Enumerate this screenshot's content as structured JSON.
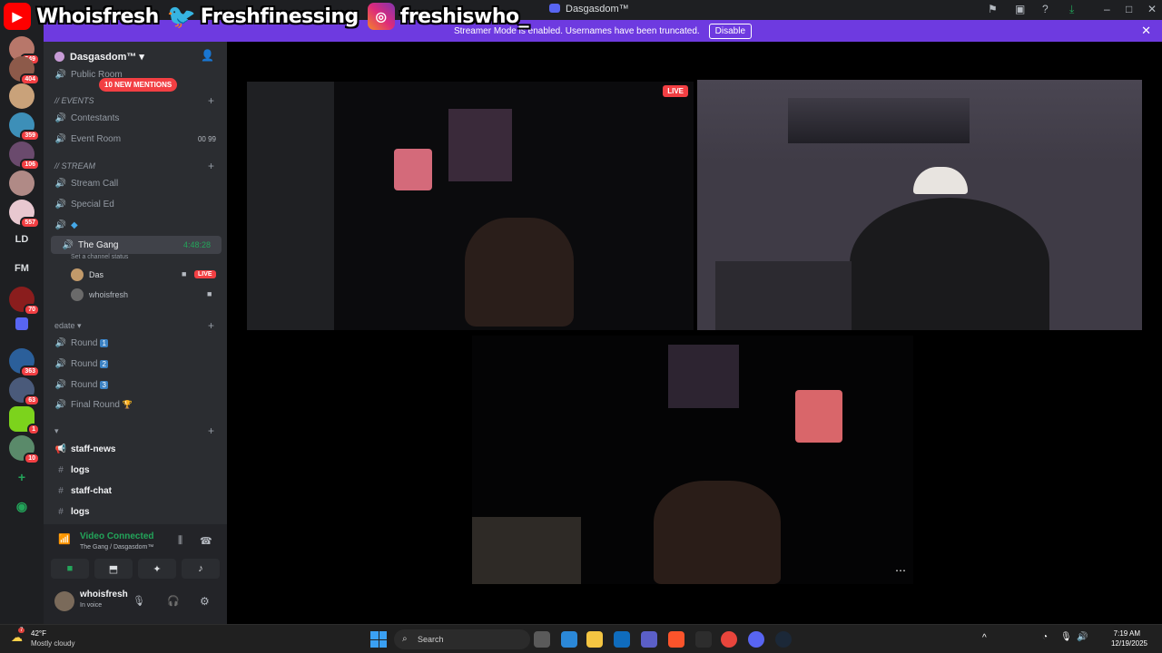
{
  "window": {
    "title": "Dasgasdom™"
  },
  "overlay": {
    "youtube": "Whoisfresh",
    "twitter": "Freshfinessing",
    "instagram": "freshiswho_"
  },
  "banner": {
    "text": "Streamer Mode is enabled. Usernames have been truncated.",
    "button": "Disable"
  },
  "rail": {
    "badges": [
      "549",
      "404",
      "359",
      "106",
      "557",
      "70",
      "363",
      "63",
      "1",
      "10"
    ],
    "text_servers": [
      "LD",
      "FM"
    ]
  },
  "guild": {
    "name": "Dasgasdom™",
    "mentions": "10 NEW MENTIONS"
  },
  "channels": {
    "public_room": "Public Room",
    "events_category": "// Events",
    "contestants": "Contestants",
    "event_room": "Event Room",
    "event_room_count_a": "00",
    "event_room_count_b": "99",
    "stream_category": "// STREAM",
    "stream_call": "Stream Call",
    "special_ed": "Special Ed",
    "the_gang": "The Gang",
    "the_gang_timer": "4:48:28",
    "set_status": "Set a channel status",
    "member_1": "Das",
    "member_1_live": "LIVE",
    "member_2": "whoisfresh",
    "edate_category": "edate",
    "round_1": "Round",
    "round_1_num": "1",
    "round_2": "Round",
    "round_2_num": "2",
    "round_3": "Round",
    "round_3_num": "3",
    "final_round": "Final Round",
    "staff_news": "staff-news",
    "logs_1": "logs",
    "staff_chat": "staff-chat",
    "logs_2": "logs"
  },
  "voice": {
    "status": "Video Connected",
    "location": "The Gang / Dasgasdom™"
  },
  "user": {
    "name": "whoisfresh",
    "status": "In voice"
  },
  "stage": {
    "live_label": "LIVE"
  },
  "taskbar": {
    "temp": "42°F",
    "condition": "Mostly cloudy",
    "weather_badge": "7",
    "search": "Search",
    "time": "7:19 AM",
    "date": "12/19/2025"
  },
  "colors": {
    "accent": "#6e3ae0",
    "live": "#f23f43",
    "connected": "#23a55a"
  }
}
